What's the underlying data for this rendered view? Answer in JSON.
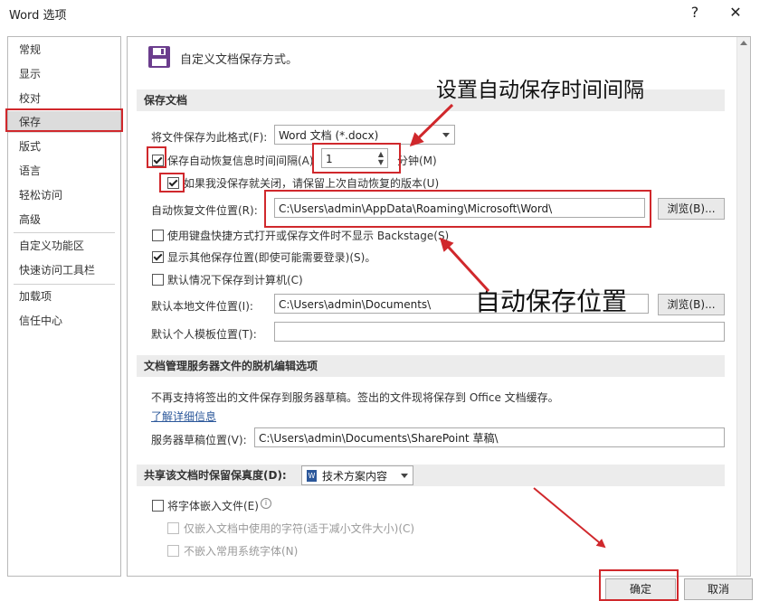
{
  "window": {
    "title": "Word 选项",
    "help_label": "?",
    "close_label": "✕"
  },
  "nav": {
    "items": [
      {
        "label": "常规"
      },
      {
        "label": "显示"
      },
      {
        "label": "校对"
      },
      {
        "label": "保存"
      },
      {
        "label": "版式"
      },
      {
        "label": "语言"
      },
      {
        "label": "轻松访问"
      },
      {
        "label": "高级"
      },
      {
        "label": "自定义功能区"
      },
      {
        "label": "快速访问工具栏"
      },
      {
        "label": "加载项"
      },
      {
        "label": "信任中心"
      }
    ],
    "selected": "保存"
  },
  "header": {
    "text": "自定义文档保存方式。",
    "icon": "save-disk-icon"
  },
  "save_docs": {
    "section": "保存文档",
    "format_label": "将文件保存为此格式(F):",
    "format_value": "Word 文档 (*.docx)",
    "autorecover_label": "保存自动恢复信息时间间隔(A)",
    "autorecover_checked": true,
    "interval_value": "1",
    "minutes_label": "分钟(M)",
    "keep_last_label": "如果我没保存就关闭，请保留上次自动恢复的版本(U)",
    "keep_last_checked": true,
    "autorecover_path_label": "自动恢复文件位置(R):",
    "autorecover_path": "C:\\Users\\admin\\AppData\\Roaming\\Microsoft\\Word\\",
    "browse1": "浏览(B)...",
    "backstage_label": "使用键盘快捷方式打开或保存文件时不显示 Backstage(S)",
    "backstage_checked": false,
    "show_other_label": "显示其他保存位置(即使可能需要登录)(S)。",
    "show_other_checked": true,
    "default_computer_label": "默认情况下保存到计算机(C)",
    "default_computer_checked": false,
    "local_path_label": "默认本地文件位置(I):",
    "local_path": "C:\\Users\\admin\\Documents\\",
    "browse2": "浏览(B)...",
    "template_label": "默认个人模板位置(T):",
    "template_path": ""
  },
  "offline": {
    "section": "文档管理服务器文件的脱机编辑选项",
    "info": "不再支持将签出的文件保存到服务器草稿。签出的文件现将保存到 Office 文档缓存。",
    "learn_more": "了解详细信息",
    "drafts_label": "服务器草稿位置(V):",
    "drafts_path": "C:\\Users\\admin\\Documents\\SharePoint 草稿\\"
  },
  "fidelity": {
    "section": "共享该文档时保留保真度(D):",
    "doc_value": "技术方案内容",
    "embed_label": "将字体嵌入文件(E)",
    "embed_checked": false,
    "only_used_label": "仅嵌入文档中使用的字符(适于减小文件大小)(C)",
    "no_common_label": "不嵌入常用系统字体(N)"
  },
  "footer": {
    "ok": "确定",
    "cancel": "取消"
  },
  "annotations": {
    "interval": "设置自动保存时间间隔",
    "location": "自动保存位置"
  },
  "colors": {
    "annotation_red": "#d0282c",
    "nav_selected": "#dcdcdc",
    "link": "#2b579a"
  }
}
